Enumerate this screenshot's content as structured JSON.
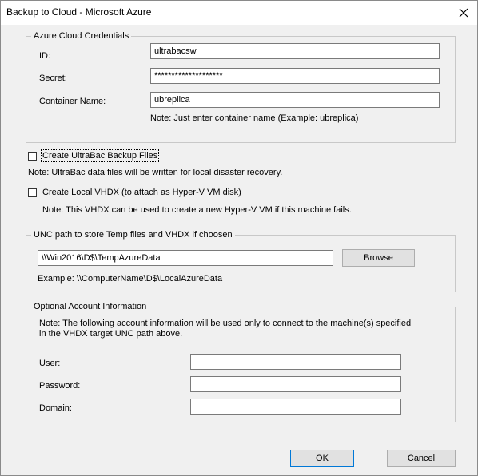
{
  "window": {
    "title": "Backup to Cloud - Microsoft Azure",
    "close_icon": "close-icon"
  },
  "credentials": {
    "legend": "Azure Cloud Credentials",
    "id_label": "ID:",
    "id_value": "ultrabacsw",
    "secret_label": "Secret:",
    "secret_value": "********************",
    "container_label": "Container Name:",
    "container_value": "ubreplica",
    "note": "Note: Just enter container name (Example: ubreplica)"
  },
  "backup_files": {
    "label": "Create UltraBac Backup Files",
    "checked": false,
    "note": "Note: UltraBac data files will be written for local disaster recovery."
  },
  "local_vhdx": {
    "label": "Create Local VHDX (to attach as Hyper-V VM disk)",
    "checked": false,
    "note": "Note: This VHDX can be used to create a new Hyper-V VM if this machine fails."
  },
  "unc": {
    "legend": "UNC path to store Temp files and VHDX if choosen",
    "path_value": "\\\\Win2016\\D$\\TempAzureData",
    "browse_label": "Browse",
    "example": "Example: \\\\ComputerName\\D$\\LocalAzureData"
  },
  "account": {
    "legend": "Optional Account Information",
    "note": "Note: The following account information will be used only to connect to the machine(s) specified in the VHDX target UNC path above.",
    "user_label": "User:",
    "user_value": "",
    "password_label": "Password:",
    "password_value": "",
    "domain_label": "Domain:",
    "domain_value": ""
  },
  "buttons": {
    "ok_label": "OK",
    "cancel_label": "Cancel"
  },
  "colors": {
    "dialog_bg": "#f0f0f0",
    "titlebar_bg": "#ffffff",
    "group_border": "#c8c8c8",
    "textbox_border": "#7a7a7a",
    "default_button_border": "#0078d7"
  }
}
